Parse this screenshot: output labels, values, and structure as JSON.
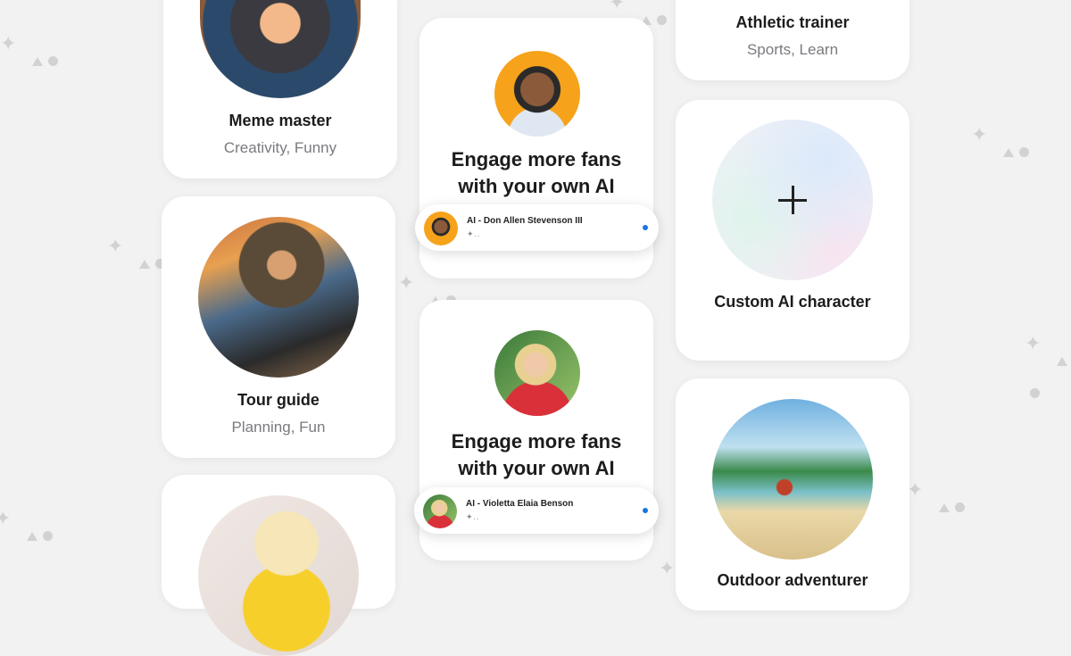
{
  "cards": {
    "meme": {
      "title": "Meme master",
      "tags": "Creativity, Funny"
    },
    "tour": {
      "title": "Tour guide",
      "tags": "Planning, Fun"
    },
    "athletic": {
      "title": "Athletic trainer",
      "tags": "Sports, Learn"
    },
    "custom": {
      "title": "Custom AI character",
      "icon": "plus-icon"
    },
    "outdoor": {
      "title": "Outdoor adventurer"
    }
  },
  "promos": [
    {
      "headline_line1": "Engage more fans",
      "headline_line2": "with your own AI",
      "chip_name": "AI - Don Allen Stevenson III",
      "chip_sub": "✦..",
      "status_color": "#1a73e8"
    },
    {
      "headline_line1": "Engage more fans",
      "headline_line2": "with your own AI",
      "chip_name": "AI - Violetta Elaia Benson",
      "chip_sub": "✦..",
      "status_color": "#1a73e8"
    }
  ],
  "colors": {
    "background": "#f2f2f2",
    "accent": "#1a73e8"
  }
}
